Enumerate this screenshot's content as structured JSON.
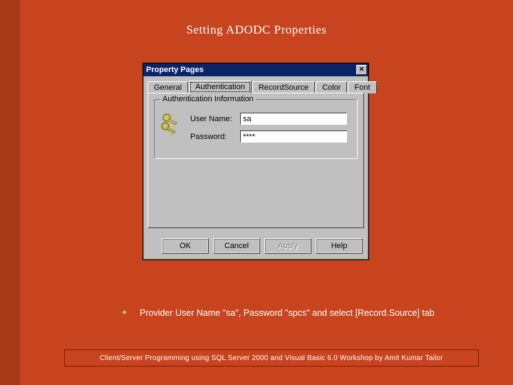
{
  "slide": {
    "title": "Setting ADODC Properties",
    "bullet_text": "Provider User Name \"sa\", Password \"spcs\" and select [Record.Source] tab",
    "footer": "Client/Server Programming using SQL Server 2000 and Visual Basic 6.0 Workshop by Amit Kumar Tailor"
  },
  "dialog": {
    "title": "Property Pages",
    "close": "✕",
    "tabs": {
      "general": "General",
      "authentication": "Authentication",
      "recordsource": "RecordSource",
      "color": "Color",
      "font": "Font"
    },
    "group_legend": "Authentication Information",
    "username_label": "User Name:",
    "username_value": "sa",
    "password_label": "Password:",
    "password_value": "****",
    "buttons": {
      "ok": "OK",
      "cancel": "Cancel",
      "apply": "Apply",
      "help": "Help"
    }
  }
}
